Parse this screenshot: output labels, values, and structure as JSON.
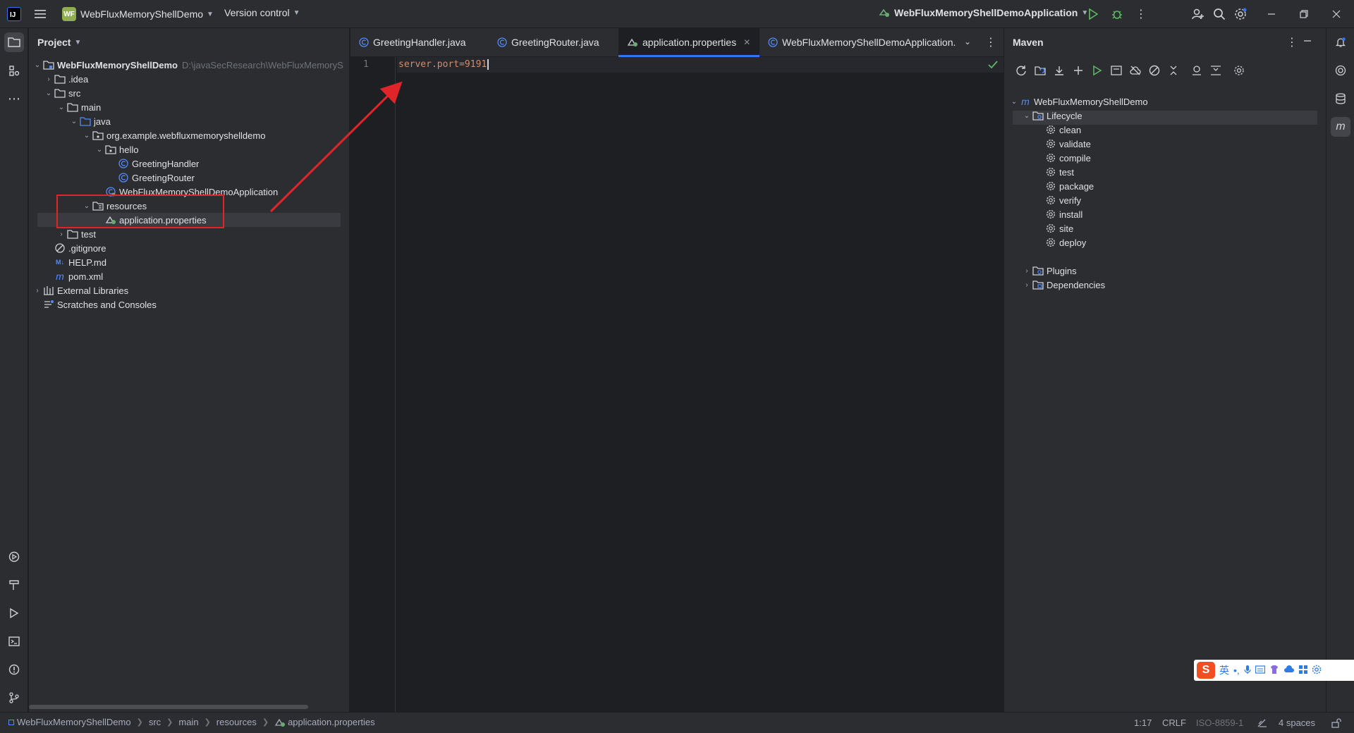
{
  "titlebar": {
    "project_badge": "WF",
    "project_name": "WebFluxMemoryShellDemo",
    "vcs_label": "Version control",
    "run_config": "WebFluxMemoryShellDemoApplication"
  },
  "project_panel": {
    "title": "Project",
    "root_name": "WebFluxMemoryShellDemo",
    "root_path": "D:\\javaSecResearch\\WebFluxMemoryS",
    "items": [
      {
        "label": ".idea"
      },
      {
        "label": "src"
      },
      {
        "label": "main"
      },
      {
        "label": "java"
      },
      {
        "label": "org.example.webfluxmemoryshelldemo"
      },
      {
        "label": "hello"
      },
      {
        "label": "GreetingHandler"
      },
      {
        "label": "GreetingRouter"
      },
      {
        "label": "WebFluxMemoryShellDemoApplication"
      },
      {
        "label": "resources"
      },
      {
        "label": "application.properties"
      },
      {
        "label": "test"
      },
      {
        "label": ".gitignore"
      },
      {
        "label": "HELP.md"
      },
      {
        "label": "pom.xml"
      },
      {
        "label": "External Libraries"
      },
      {
        "label": "Scratches and Consoles"
      }
    ]
  },
  "editor": {
    "tabs": [
      {
        "label": "GreetingHandler.java"
      },
      {
        "label": "GreetingRouter.java"
      },
      {
        "label": "application.properties"
      },
      {
        "label": "WebFluxMemoryShellDemoApplication."
      }
    ],
    "line_number": "1",
    "code": "server.port=9191"
  },
  "maven": {
    "title": "Maven",
    "project": "WebFluxMemoryShellDemo",
    "lifecycle_label": "Lifecycle",
    "goals": [
      "clean",
      "validate",
      "compile",
      "test",
      "package",
      "verify",
      "install",
      "site",
      "deploy"
    ],
    "plugins_label": "Plugins",
    "dependencies_label": "Dependencies"
  },
  "statusbar": {
    "breadcrumbs": [
      "WebFluxMemoryShellDemo",
      "src",
      "main",
      "resources",
      "application.properties"
    ],
    "position": "1:17",
    "line_sep": "CRLF",
    "encoding": "ISO-8859-1",
    "indent": "4 spaces"
  },
  "ime": {
    "lang": "英"
  },
  "colors": {
    "accent": "#3574f0",
    "annotation_red": "#e0252a",
    "keyword_orange": "#cf8e6d",
    "folder_blue": "#548af7"
  }
}
